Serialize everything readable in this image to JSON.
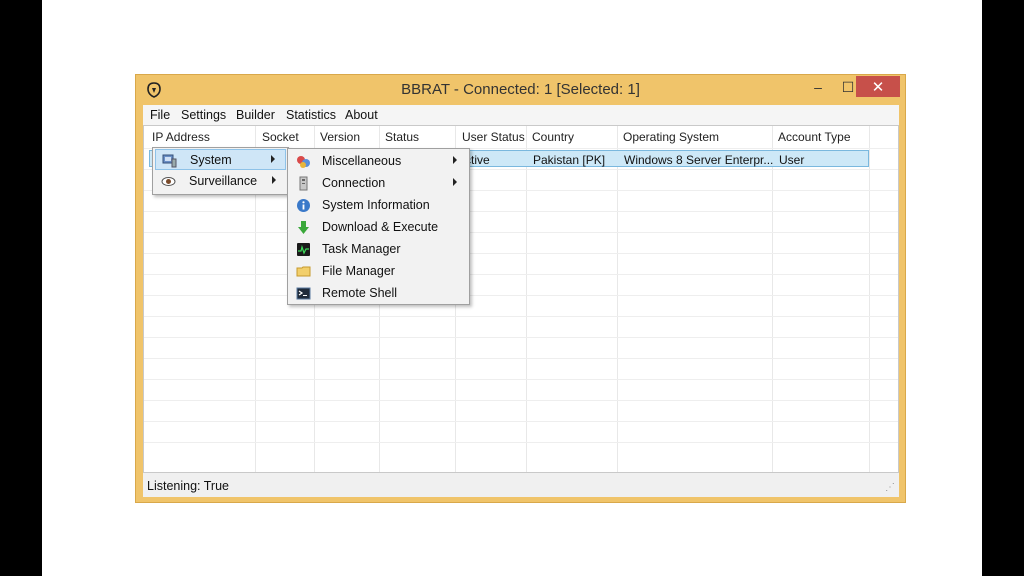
{
  "window": {
    "title": "BBRAT - Connected: 1 [Selected: 1]",
    "minimize_glyph": "–",
    "maximize_glyph": "☐",
    "close_glyph": "✕"
  },
  "menubar": [
    "File",
    "Settings",
    "Builder",
    "Statistics",
    "About"
  ],
  "columns": [
    "IP Address",
    "Socket",
    "Version",
    "Status",
    "User Status",
    "Country",
    "Operating System",
    "Account Type"
  ],
  "selected_row": {
    "user_status": "ctive",
    "country": "Pakistan [PK]",
    "operating_system": "Windows 8 Server Enterpr...",
    "account_type": "User"
  },
  "context_menu": {
    "items": [
      {
        "label": "System",
        "icon": "system-icon"
      },
      {
        "label": "Surveillance",
        "icon": "eye-icon"
      }
    ]
  },
  "submenu": {
    "items": [
      {
        "label": "Miscellaneous",
        "icon": "misc-icon"
      },
      {
        "label": "Connection",
        "icon": "connection-icon"
      },
      {
        "label": "System Information",
        "icon": "info-icon"
      },
      {
        "label": "Download & Execute",
        "icon": "download-icon"
      },
      {
        "label": "Task Manager",
        "icon": "task-manager-icon"
      },
      {
        "label": "File Manager",
        "icon": "folder-icon"
      },
      {
        "label": "Remote Shell",
        "icon": "terminal-icon"
      }
    ]
  },
  "status": "Listening: True",
  "colors": {
    "window_frame": "#f0c46a",
    "close_button": "#c7504a",
    "selection": "#cde8f7"
  }
}
